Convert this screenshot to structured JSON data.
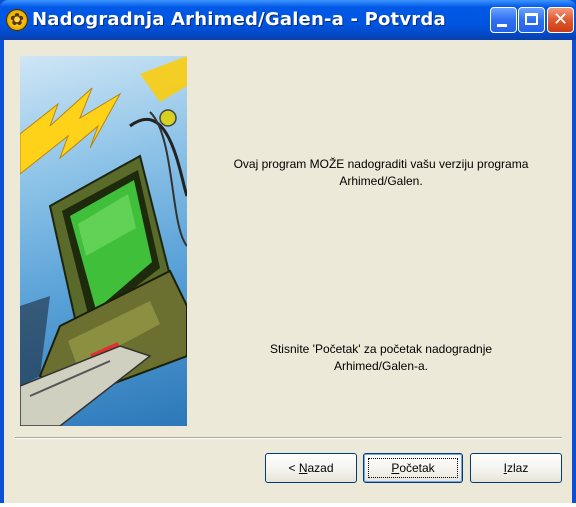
{
  "window": {
    "title": "Nadogradnja Arhimed/Galen-a - Potvrda",
    "icon": "app-icon"
  },
  "messages": {
    "line1a": "Ovaj program MOŽE nadograditi vašu verziju programa",
    "line1b": "Arhimed/Galen.",
    "line2a": "Stisnite 'Početak' za početak nadogradnje",
    "line2b": "Arhimed/Galen-a."
  },
  "buttons": {
    "back": {
      "prefix": "< ",
      "mnemonic": "N",
      "rest": "azad"
    },
    "start": {
      "mnemonic": "P",
      "rest": "očetak"
    },
    "exit": {
      "mnemonic": "I",
      "rest": "zlaz"
    }
  },
  "colors": {
    "titlebar": "#0058e6",
    "client_bg": "#ece9d8",
    "close_button": "#e0582e"
  }
}
